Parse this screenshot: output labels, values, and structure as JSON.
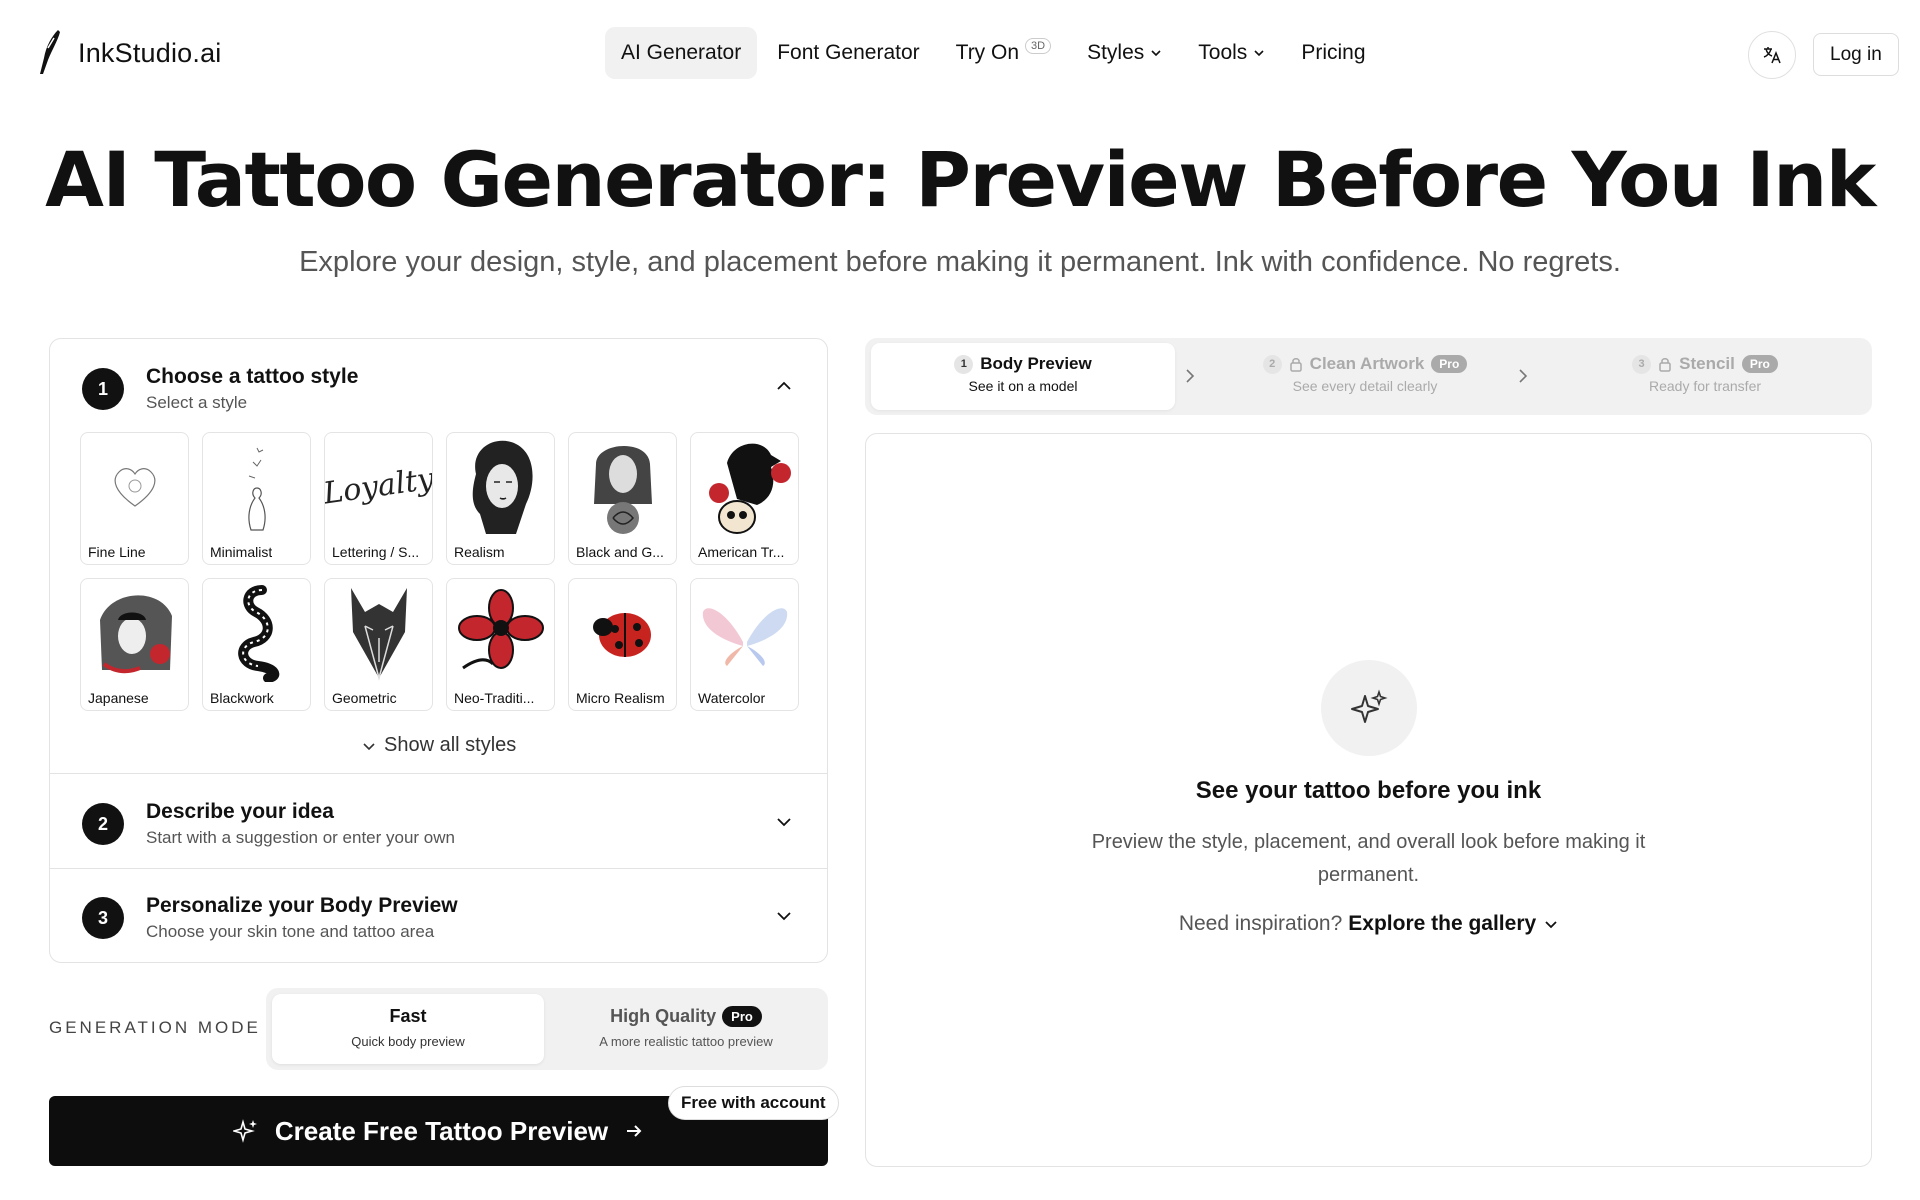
{
  "header": {
    "brand": "InkStudio.ai",
    "nav": [
      {
        "label": "AI Generator",
        "active": true
      },
      {
        "label": "Font Generator"
      },
      {
        "label": "Try On",
        "badge": "3D"
      },
      {
        "label": "Styles",
        "dropdown": true
      },
      {
        "label": "Tools",
        "dropdown": true
      },
      {
        "label": "Pricing"
      }
    ],
    "language_icon": "translate-icon",
    "login": "Log in"
  },
  "hero": {
    "title": "AI Tattoo Generator: Preview Before You Ink",
    "subtitle": "Explore your design, style, and placement before making it permanent. Ink with confidence. No regrets."
  },
  "steps": [
    {
      "num": "1",
      "title": "Choose a tattoo style",
      "desc": "Select a style",
      "expanded": true
    },
    {
      "num": "2",
      "title": "Describe your idea",
      "desc": "Start with a suggestion or enter your own"
    },
    {
      "num": "3",
      "title": "Personalize your Body Preview",
      "desc": "Choose your skin tone and tattoo area"
    }
  ],
  "styles": [
    {
      "label": "Fine Line",
      "icon": "fine-line-heart-icon"
    },
    {
      "label": "Minimalist",
      "icon": "minimalist-cat-icon"
    },
    {
      "label": "Lettering / S...",
      "icon": "lettering-script-icon"
    },
    {
      "label": "Realism",
      "icon": "realism-portrait-icon"
    },
    {
      "label": "Black and G...",
      "icon": "rose-portrait-icon"
    },
    {
      "label": "American Tr...",
      "icon": "raven-skull-icon"
    },
    {
      "label": "Japanese",
      "icon": "dragon-geisha-icon"
    },
    {
      "label": "Blackwork",
      "icon": "snake-icon"
    },
    {
      "label": "Geometric",
      "icon": "wolf-icon"
    },
    {
      "label": "Neo-Traditi...",
      "icon": "flower-icon"
    },
    {
      "label": "Micro Realism",
      "icon": "ladybug-icon"
    },
    {
      "label": "Watercolor",
      "icon": "butterfly-wings-icon"
    }
  ],
  "show_all": "Show all styles",
  "generation_mode": {
    "label": "GENERATION MODE",
    "options": [
      {
        "title": "Fast",
        "desc": "Quick body preview",
        "active": true
      },
      {
        "title": "High Quality",
        "desc": "A more realistic tattoo preview",
        "badge": "Pro"
      }
    ]
  },
  "cta": {
    "label": "Create Free Tattoo Preview",
    "badge": "Free with account"
  },
  "stepper": [
    {
      "num": "1",
      "title": "Body Preview",
      "desc": "See it on a model",
      "active": true
    },
    {
      "num": "2",
      "title": "Clean Artwork",
      "desc": "See every detail clearly",
      "badge": "Pro",
      "locked": true
    },
    {
      "num": "3",
      "title": "Stencil",
      "desc": "Ready for transfer",
      "badge": "Pro",
      "locked": true
    }
  ],
  "preview": {
    "title": "See your tattoo before you ink",
    "desc": "Preview the style, placement, and overall look before making it permanent.",
    "inspiration_prefix": "Need inspiration?",
    "inspiration_link": "Explore the gallery"
  },
  "colors": {
    "primary": "#0d0d0d",
    "muted": "#f1f1f1",
    "border": "#e3e3e3",
    "ladybug": "#c8241f",
    "rose": "#c4262e"
  }
}
